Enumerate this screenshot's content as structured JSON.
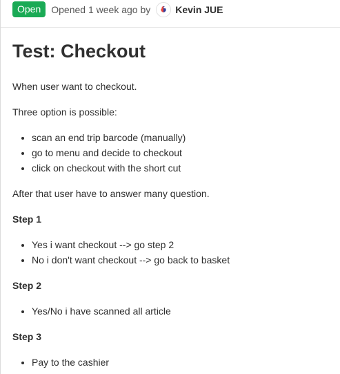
{
  "header": {
    "status": "Open",
    "opened_text": "Opened 1 week ago by",
    "author": "Kevin JUE"
  },
  "issue": {
    "title": "Test: Checkout"
  },
  "description": {
    "intro": "When user want to checkout.",
    "options_intro": "Three option is possible:",
    "options": [
      "scan an end trip barcode (manually)",
      "go to menu and decide to checkout",
      "click on checkout with the short cut"
    ],
    "after_text": "After that user have to answer many question.",
    "steps": [
      {
        "heading": "Step 1",
        "items": [
          "Yes i want checkout --> go step 2",
          "No i don't want checkout --> go back to basket"
        ]
      },
      {
        "heading": "Step 2",
        "items": [
          "Yes/No i have scanned all article"
        ]
      },
      {
        "heading": "Step 3",
        "items": [
          "Pay to the cashier"
        ]
      }
    ]
  },
  "colors": {
    "open_badge": "#1aaa55",
    "text": "#303030",
    "muted": "#555555",
    "divider": "#e5e5e5"
  }
}
